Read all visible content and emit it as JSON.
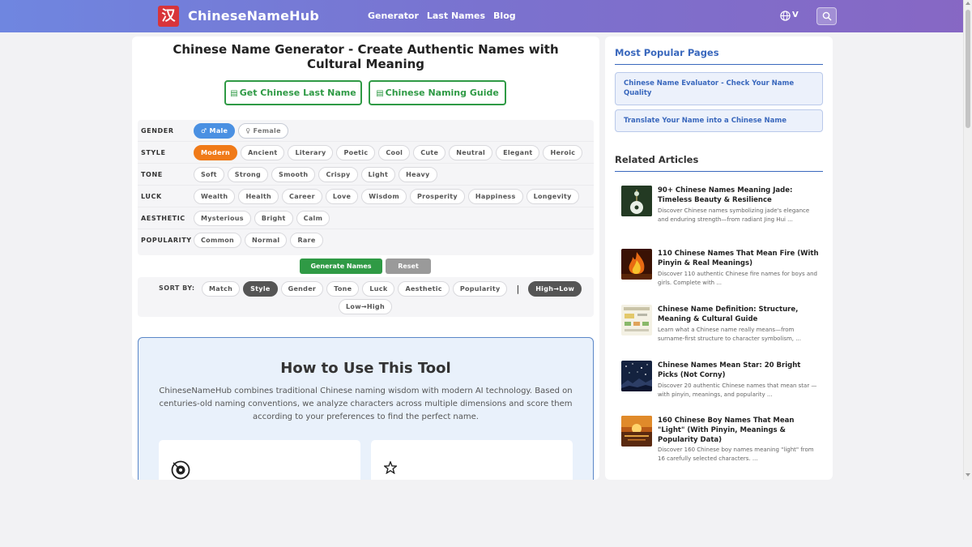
{
  "header": {
    "logo_char": "汉",
    "brand": "ChineseNameHub",
    "nav": [
      "Generator",
      "Last Names",
      "Blog"
    ],
    "lang_label": "V"
  },
  "main": {
    "title": "Chinese Name Generator - Create Authentic Names with Cultural Meaning",
    "btn_last_name": "Get Chinese Last Name",
    "btn_guide": "Chinese Naming Guide",
    "filters": [
      {
        "label": "GENDER",
        "options": [
          "♂ Male",
          "♀ Female"
        ]
      },
      {
        "label": "STYLE",
        "options": [
          "Modern",
          "Ancient",
          "Literary",
          "Poetic",
          "Cool",
          "Cute",
          "Neutral",
          "Elegant",
          "Heroic"
        ]
      },
      {
        "label": "TONE",
        "options": [
          "Soft",
          "Strong",
          "Smooth",
          "Crispy",
          "Light",
          "Heavy"
        ]
      },
      {
        "label": "LUCK",
        "options": [
          "Wealth",
          "Health",
          "Career",
          "Love",
          "Wisdom",
          "Prosperity",
          "Happiness",
          "Longevity"
        ]
      },
      {
        "label": "AESTHETIC",
        "options": [
          "Mysterious",
          "Bright",
          "Calm"
        ]
      },
      {
        "label": "POPULARITY",
        "options": [
          "Common",
          "Normal",
          "Rare"
        ]
      }
    ],
    "generate_label": "Generate Names",
    "reset_label": "Reset",
    "sort_label": "SORT BY:",
    "sort_options": [
      "Match",
      "Style",
      "Gender",
      "Tone",
      "Luck",
      "Aesthetic",
      "Popularity"
    ],
    "sort_separator": "|",
    "order_options": [
      "High→Low",
      "Low→High"
    ],
    "howto_title": "How to Use This Tool",
    "howto_text": "ChineseNameHub combines traditional Chinese naming wisdom with modern AI technology. Based on centuries-old naming conventions, we analyze characters across multiple dimensions and score them according to your preferences to find the perfect name."
  },
  "sidebar": {
    "popular_heading": "Most Popular Pages",
    "popular_links": [
      "Chinese Name Evaluator - Check Your Name Quality",
      "Translate Your Name into a Chinese Name"
    ],
    "related_heading": "Related Articles",
    "articles": [
      {
        "title": "90+ Chinese Names Meaning Jade: Timeless Beauty & Resilience",
        "desc": "Discover Chinese names symbolizing jade's elegance and enduring strength—from radiant Jing Hui ..."
      },
      {
        "title": "110 Chinese Names That Mean Fire (With Pinyin & Real Meanings)",
        "desc": "Discover 110 authentic Chinese fire names for boys and girls. Complete with ..."
      },
      {
        "title": "Chinese Name Definition: Structure, Meaning & Cultural Guide",
        "desc": "Learn what a Chinese name really means—from surname-first structure to character symbolism, ..."
      },
      {
        "title": "Chinese Names Mean Star: 20 Bright Picks (Not Corny)",
        "desc": "Discover 20 authentic Chinese names that mean star —with pinyin, meanings, and popularity ..."
      },
      {
        "title": "160 Chinese Boy Names That Mean \"Light\" (With Pinyin, Meanings & Popularity Data)",
        "desc": "Discover 160 Chinese boy names meaning \"light\" from 16 carefully selected characters. ..."
      }
    ]
  }
}
